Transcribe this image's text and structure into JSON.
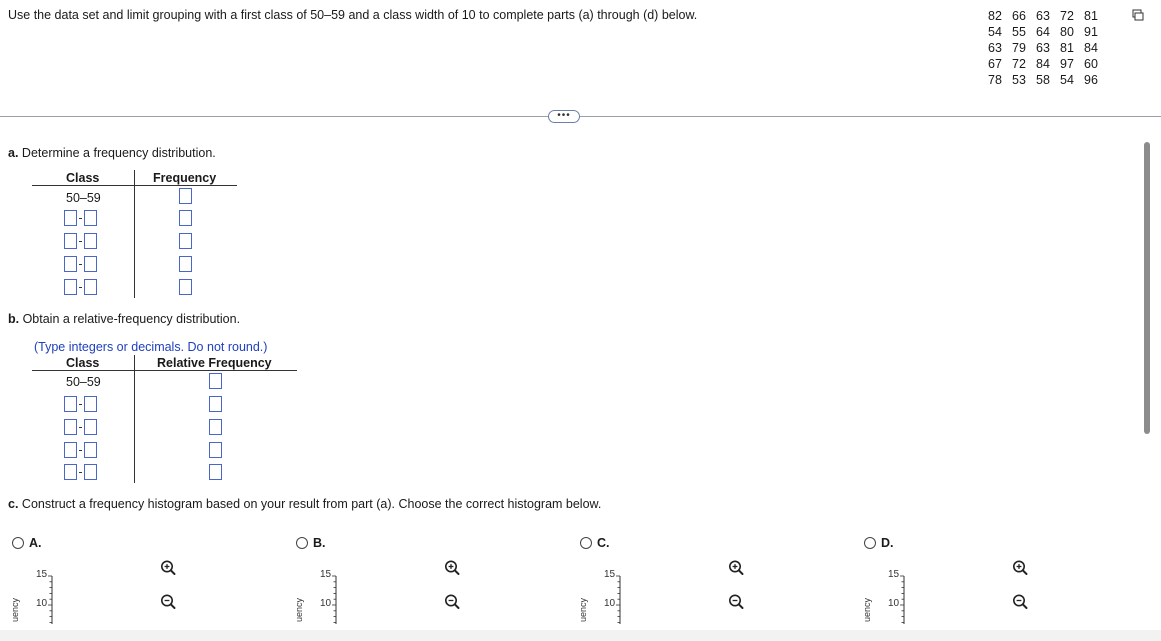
{
  "prompt": "Use the data set and limit grouping with a first class of 50–59 and a class width of 10 to complete parts (a) through (d) below.",
  "dataset": [
    [
      "82",
      "66",
      "63",
      "72",
      "81"
    ],
    [
      "54",
      "55",
      "64",
      "80",
      "91"
    ],
    [
      "63",
      "79",
      "63",
      "81",
      "84"
    ],
    [
      "67",
      "72",
      "84",
      "97",
      "60"
    ],
    [
      "78",
      "53",
      "58",
      "54",
      "96"
    ]
  ],
  "part_a": {
    "label": "a.",
    "text": " Determine a frequency distribution.",
    "col_class": "Class",
    "col_freq": "Frequency",
    "first_class": "50–59"
  },
  "part_b": {
    "label": "b.",
    "text": " Obtain a relative-frequency distribution.",
    "hint": "(Type integers or decimals. Do not round.)",
    "col_class": "Class",
    "col_relfreq": "Relative Frequency",
    "first_class": "50–59"
  },
  "part_c": {
    "label": "c.",
    "text": " Construct a frequency histogram based on your result from part (a). Choose the correct histogram below."
  },
  "options": [
    {
      "letter": "A.",
      "tick15": "15",
      "tick10": "10",
      "ylabel": "uency"
    },
    {
      "letter": "B.",
      "tick15": "15",
      "tick10": "10",
      "ylabel": "uency"
    },
    {
      "letter": "C.",
      "tick15": "15",
      "tick10": "10",
      "ylabel": "uency"
    },
    {
      "letter": "D.",
      "tick15": "15",
      "tick10": "10",
      "ylabel": "uency"
    }
  ],
  "ellipsis": "•••",
  "colors": {
    "accent": "#4a66c7",
    "hint": "#1f3fbf"
  }
}
